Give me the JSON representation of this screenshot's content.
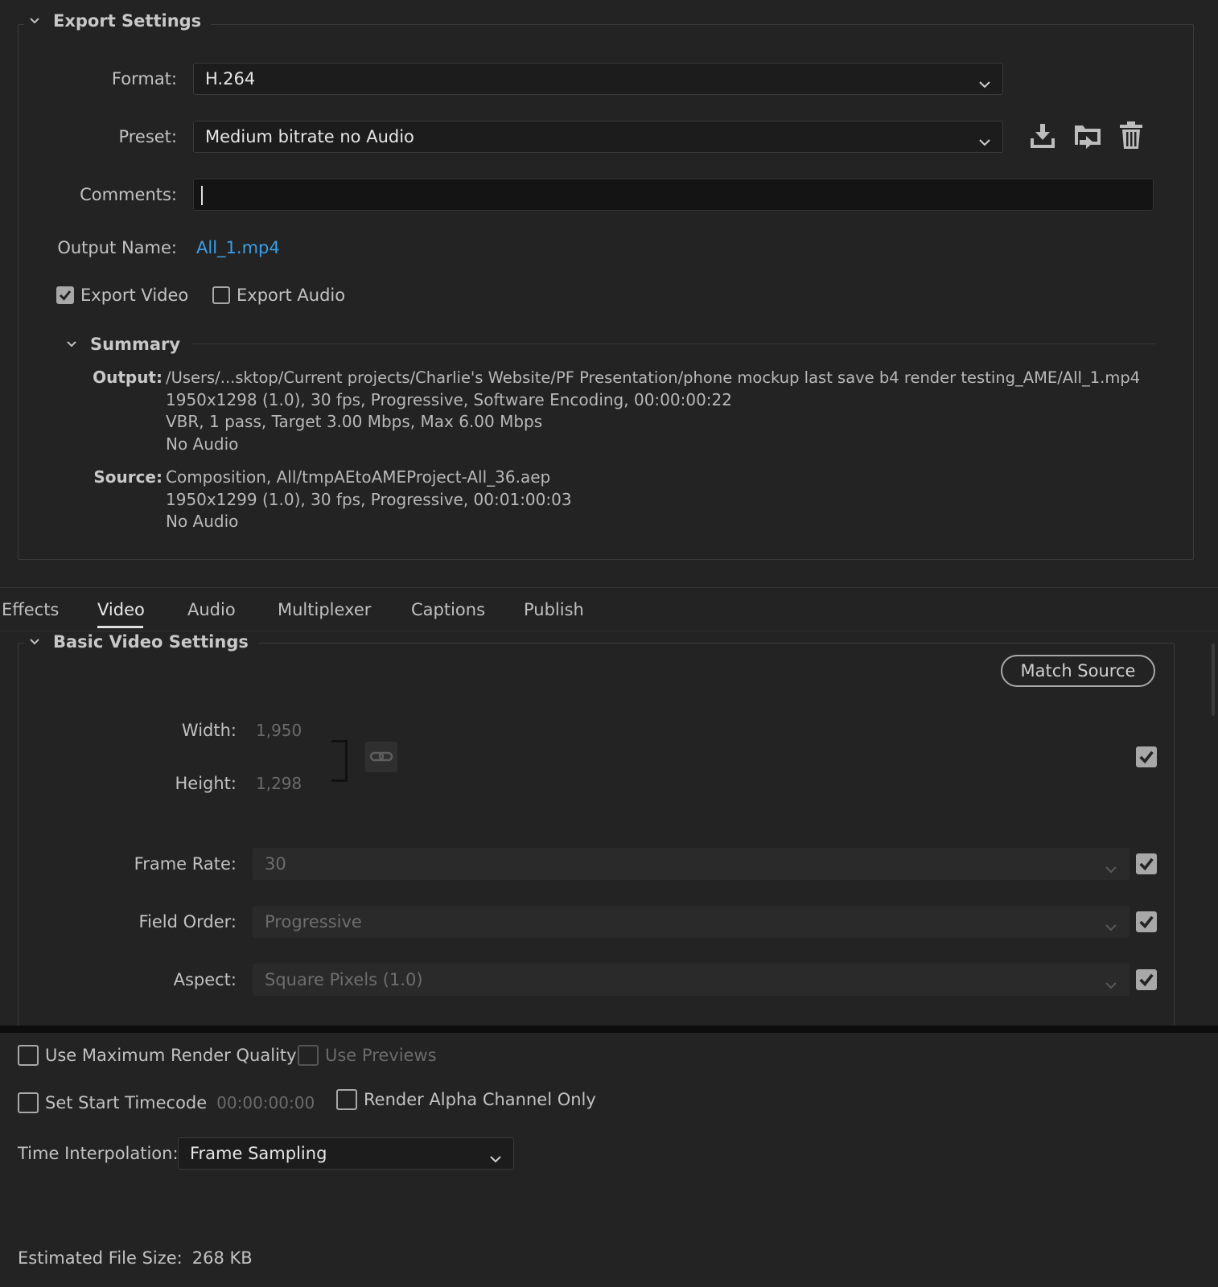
{
  "export_settings": {
    "title": "Export Settings",
    "format_label": "Format:",
    "format_value": "H.264",
    "preset_label": "Preset:",
    "preset_value": "Medium bitrate no Audio",
    "comments_label": "Comments:",
    "comments_value": "",
    "output_name_label": "Output Name:",
    "output_name_value": "All_1.mp4",
    "export_video_label": "Export Video",
    "export_video_checked": true,
    "export_audio_label": "Export Audio",
    "export_audio_checked": false
  },
  "summary": {
    "title": "Summary",
    "output_label": "Output:",
    "output_lines": [
      "/Users/...sktop/Current projects/Charlie's Website/PF Presentation/phone mockup last save b4 render testing_AME/All_1.mp4",
      "1950x1298 (1.0), 30 fps, Progressive, Software Encoding, 00:00:00:22",
      "VBR, 1 pass, Target 3.00 Mbps, Max 6.00 Mbps",
      "No Audio"
    ],
    "source_label": "Source:",
    "source_lines": [
      "Composition, All/tmpAEtoAMEProject-All_36.aep",
      "1950x1299 (1.0), 30 fps, Progressive, 00:01:00:03",
      "No Audio"
    ]
  },
  "tabs": [
    "Effects",
    "Video",
    "Audio",
    "Multiplexer",
    "Captions",
    "Publish"
  ],
  "active_tab": "Video",
  "basic_video": {
    "title": "Basic Video Settings",
    "match_source_label": "Match Source",
    "width_label": "Width:",
    "width_value": "1,950",
    "height_label": "Height:",
    "height_value": "1,298",
    "frame_rate_label": "Frame Rate:",
    "frame_rate_value": "30",
    "field_order_label": "Field Order:",
    "field_order_value": "Progressive",
    "aspect_label": "Aspect:",
    "aspect_value": "Square Pixels (1.0)"
  },
  "bottom": {
    "max_render_quality_label": "Use Maximum Render Quality",
    "use_previews_label": "Use Previews",
    "set_start_timecode_label": "Set Start Timecode",
    "start_timecode_value": "00:00:00:00",
    "render_alpha_label": "Render Alpha Channel Only",
    "time_interpolation_label": "Time Interpolation:",
    "time_interpolation_value": "Frame Sampling",
    "estimated_size_label": "Estimated File Size:",
    "estimated_size_value": "268 KB"
  },
  "colors": {
    "background": "#232323",
    "link": "#3a9fe8",
    "checkbox": "#a8a8a8"
  }
}
